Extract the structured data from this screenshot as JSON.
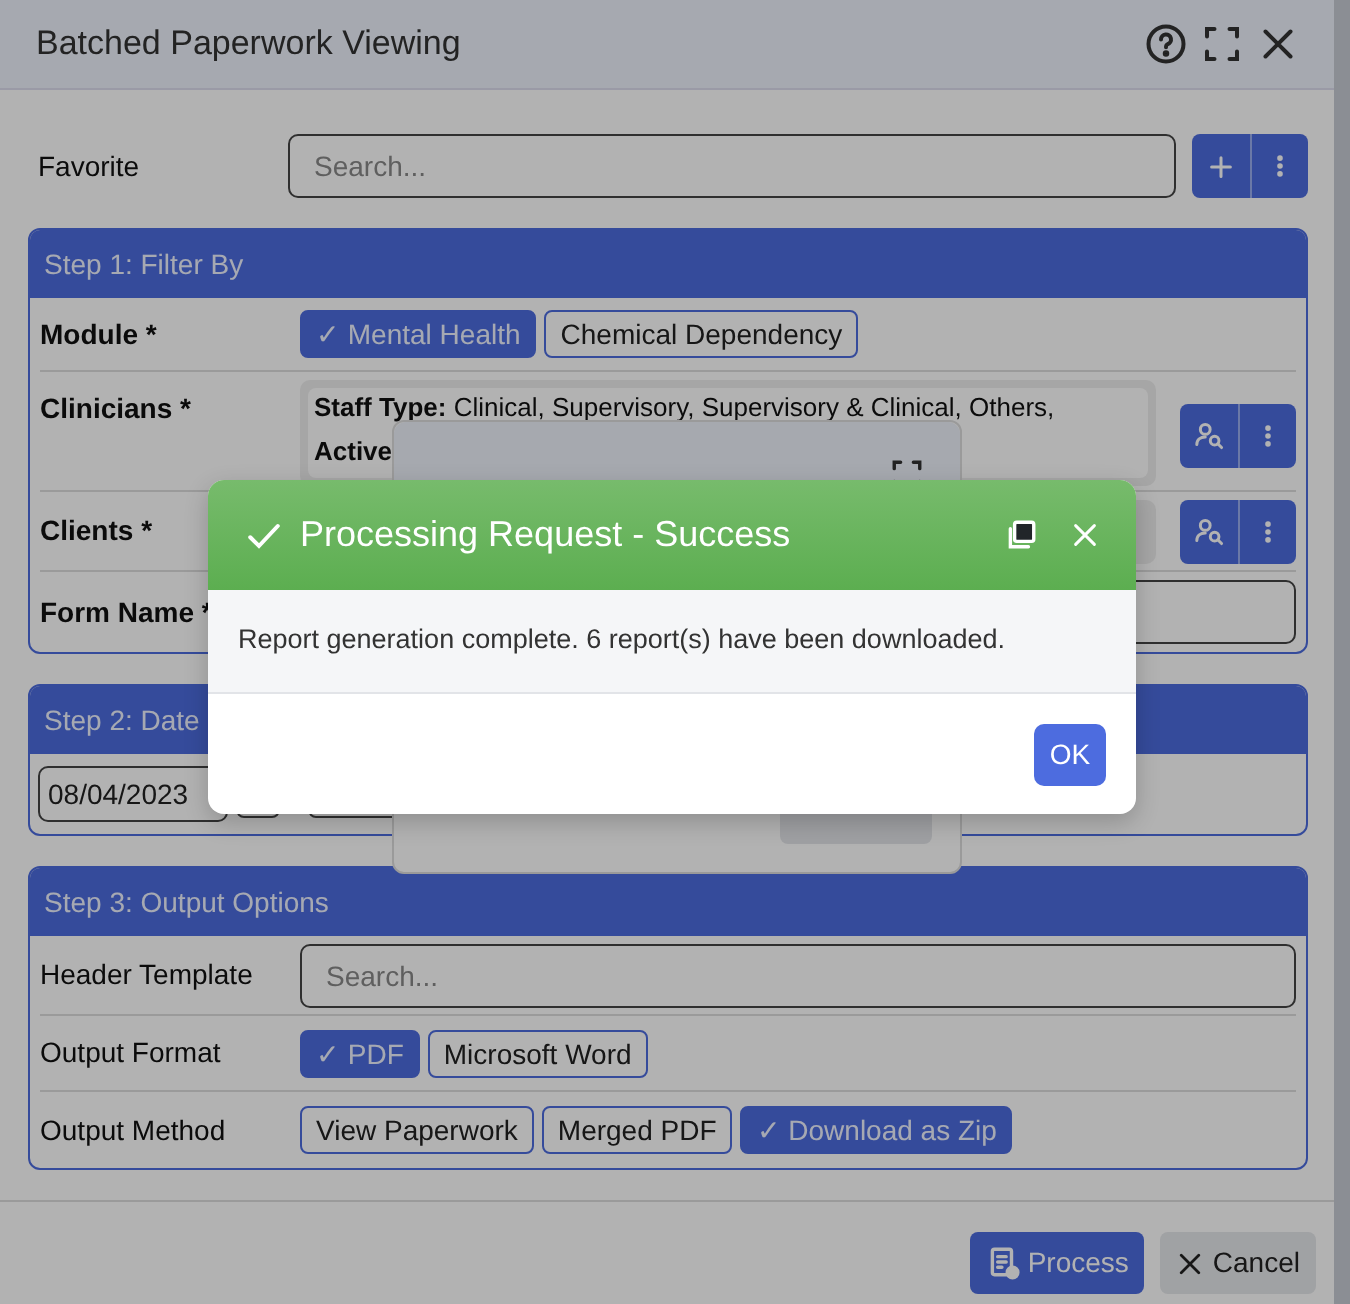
{
  "dialog": {
    "title": "Batched Paperwork Viewing"
  },
  "favorite": {
    "label": "Favorite",
    "placeholder": "Search..."
  },
  "step1": {
    "title": "Step 1: Filter By",
    "module": {
      "label": "Module *",
      "options": [
        {
          "label": "✓ Mental Health",
          "selected": true
        },
        {
          "label": "Chemical Dependency",
          "selected": false
        }
      ]
    },
    "clinicians": {
      "label": "Clinicians *",
      "lines": [
        {
          "label": "Staff Type:",
          "value": "Clinical, Supervisory, Supervisory & Clinical, Others,"
        },
        {
          "label": "Active"
        }
      ]
    },
    "clients": {
      "label": "Clients *"
    },
    "form_name": {
      "label": "Form Name *"
    }
  },
  "step2": {
    "title": "Step 2: Date",
    "date": "08/04/2023"
  },
  "step3": {
    "title": "Step 3: Output Options",
    "header_template": {
      "label": "Header Template",
      "placeholder": "Search..."
    },
    "output_format": {
      "label": "Output Format",
      "options": [
        {
          "label": "✓ PDF",
          "selected": true
        },
        {
          "label": "Microsoft Word",
          "selected": false
        }
      ]
    },
    "output_method": {
      "label": "Output Method",
      "options": [
        {
          "label": "View Paperwork",
          "selected": false
        },
        {
          "label": "Merged PDF",
          "selected": false
        },
        {
          "label": "✓ Download as Zip",
          "selected": true
        }
      ]
    }
  },
  "footer": {
    "process": "Process",
    "cancel": "Cancel"
  },
  "success_modal": {
    "title": "Processing Request - Success",
    "message": "Report generation complete. 6 report(s) have been downloaded.",
    "ok": "OK"
  }
}
